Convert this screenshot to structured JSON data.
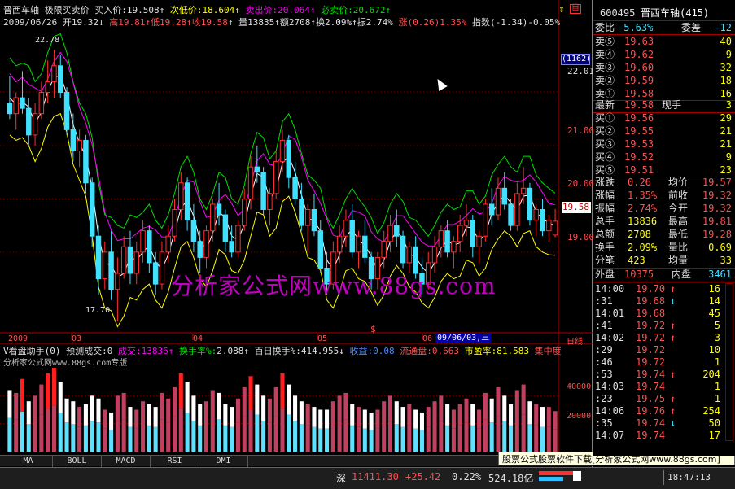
{
  "header": {
    "name": "晋西车轴",
    "mode": "极限买卖价",
    "buy_label": "买入价:",
    "buy_val": "19.508",
    "sub_label": "次低价:",
    "sub_val": "18.604",
    "sell_label": "卖出价:",
    "sell_val": "20.064",
    "must_label": "必卖价:",
    "must_val": "20.672",
    "date": "2009/06/26",
    "open": "开19.32",
    "high": "高19.81",
    "low": "低19.28",
    "close": "收19.58",
    "vol": "量13835",
    "amount": "额2708",
    "turnover": "换2.09%",
    "amplitude": "振2.74%",
    "change": "涨(0.26)1.35%",
    "index": "指数(-1.34)-0.05%"
  },
  "price_axis": [
    "22.01",
    "21.00",
    "20.00",
    "19.00"
  ],
  "count_box": "(1162)",
  "cur_price_tag": "19.58",
  "high_mark": "22.78",
  "low_mark": "17.70",
  "months": [
    "2009",
    "03",
    "04",
    "05",
    "06"
  ],
  "date_tag": "09/06/03,三",
  "period_label": "日线",
  "indicator": {
    "name": "V看盘助手(0)",
    "forecast": "预测成交:0",
    "vol_label": "成交:",
    "vol_val": "13836",
    "turn_label": "换手率%:",
    "turn_val": "2.088",
    "hundred_label": "百日换手%:",
    "hundred_val": "414.955",
    "gain_label": "收益:",
    "gain_val": "0.08",
    "float_label": "流通盘:",
    "float_val": "0.663",
    "pe_label": "市盈率:",
    "pe_val": "81.583",
    "conc_label": "集中度",
    "source": "分析家公式网www.88gs.com专版",
    "axis": [
      "40000",
      "20000"
    ]
  },
  "watermark": "分析家公式网www.88gs.com",
  "tabs": [
    "MA",
    "BOLL",
    "MACD",
    "RSI",
    "DMI"
  ],
  "ad_text": "股票公式股票软件下载[分析家公式网www.88gs.com]",
  "status": {
    "market": "深",
    "index": "11411.30",
    "change": "+25.42",
    "pct": "0.22%",
    "amount": "524.18亿",
    "time": "18:47:13"
  },
  "quote": {
    "code": "600495",
    "name": "晋西车轴(415)",
    "ratio_label": "委比",
    "ratio_val": "-5.63%",
    "diff_label": "委差",
    "diff_val": "-12",
    "asks": [
      {
        "label": "卖⑤",
        "price": "19.63",
        "vol": "40"
      },
      {
        "label": "卖④",
        "price": "19.62",
        "vol": "9"
      },
      {
        "label": "卖③",
        "price": "19.60",
        "vol": "32"
      },
      {
        "label": "卖②",
        "price": "19.59",
        "vol": "18"
      },
      {
        "label": "卖①",
        "price": "19.58",
        "vol": "16"
      }
    ],
    "last_label": "最新",
    "last_price": "19.58",
    "hand_label": "现手",
    "hand_val": "3",
    "bids": [
      {
        "label": "买①",
        "price": "19.56",
        "vol": "29"
      },
      {
        "label": "买②",
        "price": "19.55",
        "vol": "21"
      },
      {
        "label": "买③",
        "price": "19.53",
        "vol": "21"
      },
      {
        "label": "买④",
        "price": "19.52",
        "vol": "9"
      },
      {
        "label": "买⑤",
        "price": "19.51",
        "vol": "23"
      }
    ],
    "stats": [
      {
        "l1": "涨跌",
        "v1": "0.26",
        "l2": "均价",
        "v2": "19.57"
      },
      {
        "l1": "涨幅",
        "v1": "1.35%",
        "l2": "前收",
        "v2": "19.32"
      },
      {
        "l1": "振幅",
        "v1": "2.74%",
        "l2": "今开",
        "v2": "19.32"
      },
      {
        "l1": "总手",
        "v1": "13836",
        "l2": "最高",
        "v2": "19.81"
      },
      {
        "l1": "总额",
        "v1": "2708",
        "l2": "最低",
        "v2": "19.28"
      },
      {
        "l1": "换手",
        "v1": "2.09%",
        "l2": "量比",
        "v2": "0.69"
      },
      {
        "l1": "分笔",
        "v1": "423",
        "l2": "均量",
        "v2": "33"
      }
    ],
    "outer_label": "外盘",
    "outer_val": "10375",
    "inner_label": "内盘",
    "inner_val": "3461",
    "ticks": [
      {
        "t": "14:00",
        "p": "19.70",
        "d": "↑",
        "v": "16"
      },
      {
        "t": ":31",
        "p": "19.68",
        "d": "↓",
        "v": "14"
      },
      {
        "t": "14:01",
        "p": "19.68",
        "d": "",
        "v": "45"
      },
      {
        "t": ":41",
        "p": "19.72",
        "d": "↑",
        "v": "5"
      },
      {
        "t": "14:02",
        "p": "19.72",
        "d": "↑",
        "v": "3"
      },
      {
        "t": ":29",
        "p": "19.72",
        "d": "",
        "v": "10"
      },
      {
        "t": ":46",
        "p": "19.72",
        "d": "",
        "v": "1"
      },
      {
        "t": ":53",
        "p": "19.74",
        "d": "↑",
        "v": "204"
      },
      {
        "t": "14:03",
        "p": "19.74",
        "d": "",
        "v": "1"
      },
      {
        "t": ":23",
        "p": "19.75",
        "d": "↑",
        "v": "1"
      },
      {
        "t": "14:06",
        "p": "19.76",
        "d": "↑",
        "v": "254"
      },
      {
        "t": ":35",
        "p": "19.74",
        "d": "↓",
        "v": "50"
      },
      {
        "t": "14:07",
        "p": "19.74",
        "d": "",
        "v": "17"
      }
    ]
  },
  "chart_data": {
    "type": "candlestick",
    "ylim": [
      17.5,
      23.2
    ],
    "candles": [
      [
        21.8,
        22.3,
        21.5,
        21.6
      ],
      [
        21.6,
        22.0,
        21.3,
        21.9
      ],
      [
        21.9,
        22.4,
        21.6,
        21.7
      ],
      [
        21.7,
        21.9,
        21.0,
        21.2
      ],
      [
        21.2,
        21.8,
        21.0,
        21.6
      ],
      [
        21.6,
        22.2,
        21.5,
        22.0
      ],
      [
        22.0,
        22.6,
        21.8,
        22.2
      ],
      [
        22.2,
        22.8,
        21.9,
        22.5
      ],
      [
        22.5,
        22.7,
        21.9,
        22.0
      ],
      [
        22.0,
        22.1,
        21.2,
        21.3
      ],
      [
        21.3,
        21.6,
        20.7,
        20.9
      ],
      [
        20.9,
        21.3,
        20.6,
        21.1
      ],
      [
        21.1,
        21.2,
        20.1,
        20.3
      ],
      [
        20.3,
        20.4,
        19.1,
        19.3
      ],
      [
        19.3,
        19.5,
        18.2,
        18.5
      ],
      [
        18.5,
        19.2,
        18.3,
        19.0
      ],
      [
        19.0,
        19.4,
        18.1,
        18.3
      ],
      [
        18.3,
        18.9,
        17.7,
        18.6
      ],
      [
        18.6,
        19.3,
        18.5,
        19.1
      ],
      [
        19.1,
        19.4,
        18.4,
        18.6
      ],
      [
        18.6,
        19.2,
        18.4,
        19.0
      ],
      [
        19.0,
        19.6,
        18.8,
        19.4
      ],
      [
        19.4,
        19.5,
        18.6,
        18.8
      ],
      [
        18.8,
        19.0,
        18.2,
        18.4
      ],
      [
        18.4,
        19.2,
        18.3,
        19.0
      ],
      [
        19.0,
        19.5,
        18.8,
        19.3
      ],
      [
        19.3,
        20.0,
        19.2,
        19.8
      ],
      [
        19.8,
        20.5,
        19.6,
        20.3
      ],
      [
        20.3,
        20.4,
        19.4,
        19.6
      ],
      [
        19.6,
        19.9,
        19.0,
        19.2
      ],
      [
        19.2,
        19.4,
        18.6,
        18.9
      ],
      [
        18.9,
        19.5,
        18.7,
        19.4
      ],
      [
        19.4,
        20.0,
        19.2,
        19.9
      ],
      [
        19.9,
        20.3,
        19.5,
        19.7
      ],
      [
        19.7,
        19.8,
        19.0,
        19.2
      ],
      [
        19.2,
        19.5,
        18.9,
        19.0
      ],
      [
        19.0,
        19.6,
        18.9,
        19.5
      ],
      [
        19.5,
        20.2,
        19.4,
        20.0
      ],
      [
        20.0,
        20.8,
        19.8,
        20.6
      ],
      [
        20.6,
        21.0,
        20.3,
        20.5
      ],
      [
        20.5,
        20.6,
        19.7,
        19.8
      ],
      [
        19.8,
        20.2,
        19.5,
        20.1
      ],
      [
        20.1,
        20.9,
        20.0,
        20.7
      ],
      [
        20.7,
        21.3,
        20.5,
        21.1
      ],
      [
        21.1,
        21.2,
        20.2,
        20.4
      ],
      [
        20.4,
        20.7,
        19.9,
        20.0
      ],
      [
        20.0,
        20.3,
        19.4,
        19.5
      ],
      [
        19.5,
        19.9,
        19.0,
        19.8
      ],
      [
        19.8,
        20.1,
        19.3,
        19.4
      ],
      [
        19.4,
        19.6,
        18.6,
        18.7
      ],
      [
        18.7,
        19.0,
        18.2,
        18.4
      ],
      [
        18.4,
        19.2,
        18.3,
        19.0
      ],
      [
        19.0,
        19.5,
        18.8,
        19.3
      ],
      [
        19.3,
        19.8,
        19.1,
        19.6
      ],
      [
        19.6,
        19.9,
        18.9,
        19.0
      ],
      [
        19.0,
        19.4,
        18.7,
        19.3
      ],
      [
        19.3,
        19.6,
        18.8,
        18.9
      ],
      [
        18.9,
        19.0,
        18.3,
        18.5
      ],
      [
        18.5,
        19.0,
        18.3,
        18.9
      ],
      [
        18.9,
        19.4,
        18.7,
        19.2
      ],
      [
        19.2,
        19.7,
        19.0,
        19.5
      ],
      [
        19.5,
        19.8,
        19.1,
        19.3
      ],
      [
        19.3,
        19.4,
        18.7,
        18.8
      ],
      [
        18.8,
        19.2,
        18.6,
        19.1
      ],
      [
        19.1,
        19.3,
        18.5,
        18.6
      ],
      [
        18.6,
        18.9,
        18.2,
        18.4
      ],
      [
        18.4,
        19.0,
        18.3,
        18.8
      ],
      [
        18.8,
        19.3,
        18.6,
        19.1
      ],
      [
        19.1,
        19.5,
        18.9,
        19.4
      ],
      [
        19.4,
        19.6,
        18.9,
        19.0
      ],
      [
        19.0,
        19.3,
        18.7,
        19.2
      ],
      [
        19.2,
        19.7,
        19.0,
        19.5
      ],
      [
        19.5,
        19.9,
        19.3,
        19.6
      ],
      [
        19.6,
        19.7,
        18.9,
        19.1
      ],
      [
        19.1,
        19.4,
        18.8,
        19.3
      ],
      [
        19.3,
        20.0,
        19.2,
        19.9
      ],
      [
        19.9,
        20.2,
        19.5,
        19.7
      ],
      [
        19.7,
        20.4,
        19.6,
        20.2
      ],
      [
        20.2,
        20.5,
        19.8,
        19.9
      ],
      [
        19.9,
        20.0,
        19.4,
        19.5
      ],
      [
        19.5,
        20.3,
        19.4,
        20.1
      ],
      [
        20.1,
        20.6,
        19.9,
        20.2
      ],
      [
        20.2,
        20.3,
        19.5,
        19.6
      ],
      [
        19.6,
        19.9,
        19.3,
        19.8
      ],
      [
        19.8,
        20.0,
        19.3,
        19.4
      ],
      [
        19.4,
        19.7,
        19.2,
        19.6
      ],
      [
        19.32,
        19.81,
        19.28,
        19.58
      ]
    ],
    "volumes": [
      220,
      210,
      260,
      180,
      200,
      240,
      280,
      300,
      250,
      190,
      180,
      160,
      170,
      200,
      190,
      150,
      140,
      200,
      210,
      160,
      150,
      180,
      170,
      160,
      210,
      190,
      230,
      280,
      250,
      200,
      170,
      180,
      220,
      210,
      170,
      160,
      190,
      230,
      270,
      240,
      200,
      190,
      230,
      280,
      240,
      200,
      180,
      170,
      160,
      150,
      150,
      180,
      200,
      210,
      170,
      160,
      150,
      140,
      150,
      180,
      200,
      180,
      160,
      170,
      150,
      140,
      160,
      180,
      200,
      170,
      150,
      170,
      190,
      170,
      150,
      210,
      190,
      230,
      200,
      170,
      220,
      240,
      180,
      170,
      160,
      160,
      145
    ]
  }
}
